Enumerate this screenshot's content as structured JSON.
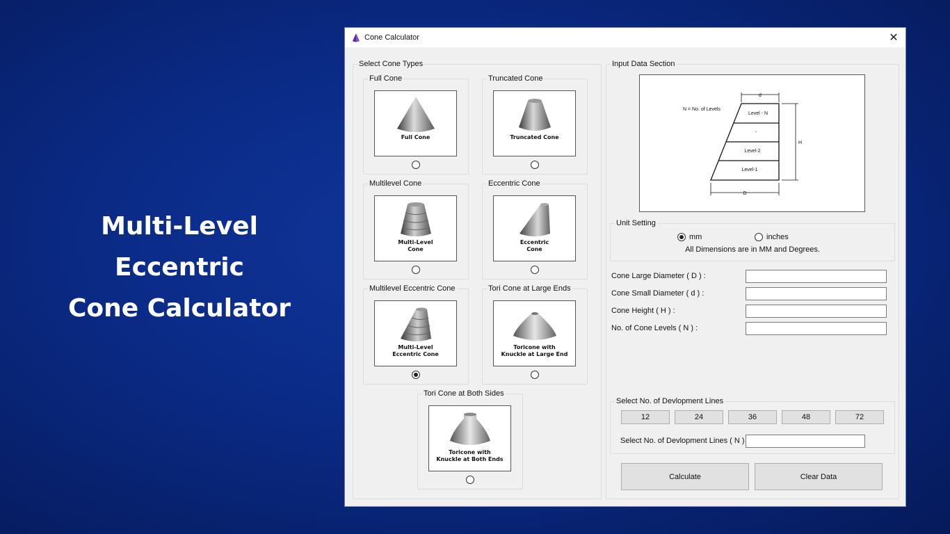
{
  "hero": {
    "line1": "Multi-Level",
    "line2": "Eccentric",
    "line3": "Cone Calculator"
  },
  "window": {
    "title": "Cone Calculator",
    "close": "✕"
  },
  "cone_types": {
    "label": "Select Cone Types",
    "items": [
      {
        "label": "Full Cone",
        "caption": "Full Cone",
        "selected": false
      },
      {
        "label": "Truncated Cone",
        "caption": "Truncated Cone",
        "selected": false
      },
      {
        "label": "Multilevel Cone",
        "caption": "Multi-Level\nCone",
        "selected": false
      },
      {
        "label": "Eccentric Cone",
        "caption": "Eccentric\nCone",
        "selected": false
      },
      {
        "label": "Multilevel Eccentric Cone",
        "caption": "Multi-Level\nEccentric Cone",
        "selected": true
      },
      {
        "label": "Tori Cone at Large Ends",
        "caption": "Toricone with\nKnuckle at Large End",
        "selected": false
      },
      {
        "label": "Tori Cone at Both Sides",
        "caption": "Toricone with\nKnuckle at Both Ends",
        "selected": false
      }
    ]
  },
  "input_section": {
    "label": "Input Data Section",
    "diagram": {
      "legend": "N = No. of Levels",
      "top_dim": "d",
      "bottom_dim": "D",
      "height_dim": "H",
      "levels": [
        "Level - N",
        "-",
        "Level-2",
        "Level-1"
      ]
    }
  },
  "unit_setting": {
    "label": "Unit Setting",
    "mm": "mm",
    "inches": "inches",
    "selected": "mm",
    "note": "All Dimensions are in MM and Degrees."
  },
  "fields": [
    {
      "label": "Cone Large Diameter ( D ) :",
      "value": ""
    },
    {
      "label": "Cone Small Diameter ( d ) :",
      "value": ""
    },
    {
      "label": "Cone Height ( H ) :",
      "value": ""
    },
    {
      "label": "No. of Cone Levels ( N ) :",
      "value": ""
    }
  ],
  "dev_lines": {
    "label": "Select No. of Devlopment Lines",
    "options": [
      "12",
      "24",
      "36",
      "48",
      "72"
    ],
    "input_label": "Select No. of Devlopment Lines ( N ) :",
    "input_value": ""
  },
  "actions": {
    "calculate": "Calculate",
    "clear": "Clear Data"
  },
  "colors": {
    "background": "#0a2a85",
    "window": "#f0f0f0",
    "title_icon": "#8a4fc7"
  }
}
